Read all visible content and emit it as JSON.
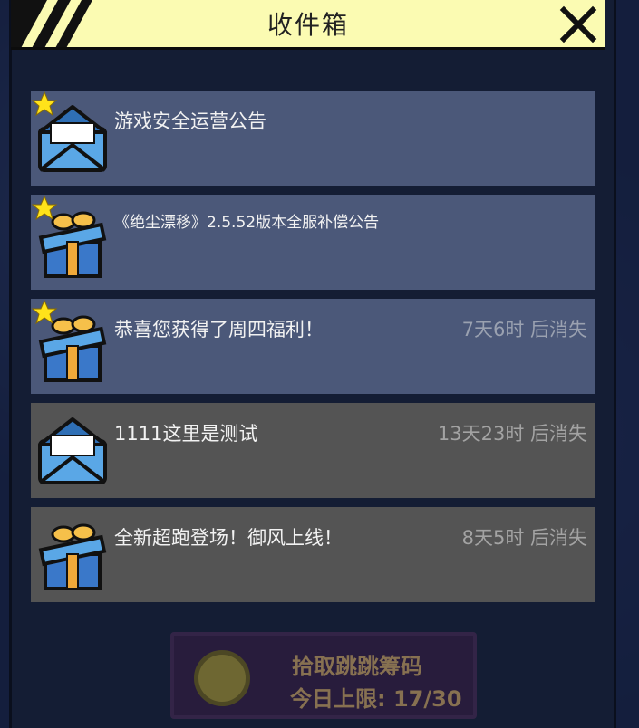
{
  "header": {
    "title": "收件箱",
    "close_icon": "close-icon"
  },
  "mails": [
    {
      "subject": "游戏安全运营公告",
      "expire": "",
      "type": "letter",
      "starred": true,
      "read": false
    },
    {
      "subject": "《绝尘漂移》2.5.52版本全服补偿公告",
      "expire": "",
      "type": "gift",
      "starred": true,
      "read": false
    },
    {
      "subject": "恭喜您获得了周四福利！",
      "expire": "7天6时 后消失",
      "type": "gift",
      "starred": true,
      "read": false
    },
    {
      "subject": "1111这里是测试",
      "expire": "13天23时 后消失",
      "type": "letter",
      "starred": false,
      "read": true
    },
    {
      "subject": "全新超跑登场！御风上线！",
      "expire": "8天5时 后消失",
      "type": "gift",
      "starred": false,
      "read": true
    }
  ],
  "bottom": {
    "line1": "拾取跳跳筹码",
    "line2": "今日上限: 17/30"
  },
  "colors": {
    "header_bg": "#fbfbb2",
    "unread_bg": "#4b5879",
    "read_bg": "#545454"
  }
}
